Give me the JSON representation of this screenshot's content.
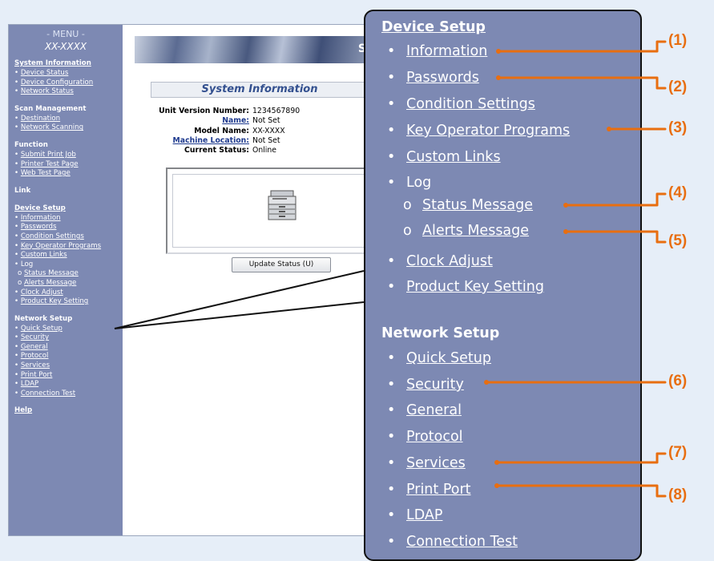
{
  "sidebar": {
    "menu_title": "- MENU -",
    "model": "XX-XXXX",
    "groups": [
      {
        "title": "System Information",
        "underline": true,
        "items": [
          "Device Status",
          "Device Configuration",
          "Network Status"
        ]
      },
      {
        "title": "Scan Management",
        "underline": false,
        "items": [
          "Destination",
          "Network Scanning"
        ]
      },
      {
        "title": "Function",
        "underline": false,
        "items": [
          "Submit Print Job",
          "Printer Test Page",
          "Web Test Page"
        ]
      },
      {
        "title": "Link",
        "underline": false,
        "items": []
      },
      {
        "title": "Device Setup",
        "underline": true,
        "items": [
          "Information",
          "Passwords",
          "Condition Settings",
          "Key Operator Programs",
          "Custom Links",
          "Log",
          "Status Message",
          "Alerts Message",
          "Clock Adjust",
          "Product Key Setting"
        ]
      },
      {
        "title": "Network Setup",
        "underline": false,
        "items": [
          "Quick Setup",
          "Security",
          "General",
          "Protocol",
          "Services",
          "Print Port",
          "LDAP",
          "Connection Test"
        ]
      },
      {
        "title": "Help",
        "underline": true,
        "items": []
      }
    ]
  },
  "banner": {
    "partial_text": "S"
  },
  "main": {
    "title": "System Information",
    "fields": [
      {
        "label": "Unit Version Number:",
        "value": "1234567890",
        "link": false
      },
      {
        "label": "Name:",
        "value": "Not Set",
        "link": true
      },
      {
        "label": "Model Name:",
        "value": "XX-XXXX",
        "link": false
      },
      {
        "label": "Machine Location:",
        "value": "Not Set",
        "link": true
      },
      {
        "label": "Current Status:",
        "value": "Online",
        "link": false
      }
    ],
    "update_button": "Update Status (U)"
  },
  "callout": {
    "device_setup_title": "Device Setup",
    "device_items": [
      "Information",
      "Passwords",
      "Condition Settings",
      "Key Operator Programs",
      "Custom Links",
      "Log",
      "Status Message",
      "Alerts Message",
      "Clock Adjust",
      "Product Key Setting"
    ],
    "network_setup_title": "Network Setup",
    "network_items": [
      "Quick Setup",
      "Security",
      "General",
      "Protocol",
      "Services",
      "Print Port",
      "LDAP",
      "Connection Test"
    ]
  },
  "annotations": [
    "(1)",
    "(2)",
    "(3)",
    "(4)",
    "(5)",
    "(6)",
    "(7)",
    "(8)"
  ],
  "colors": {
    "sidebar": "#7d89b3",
    "accent": "#e86e10",
    "link": "#1f3b8f"
  }
}
